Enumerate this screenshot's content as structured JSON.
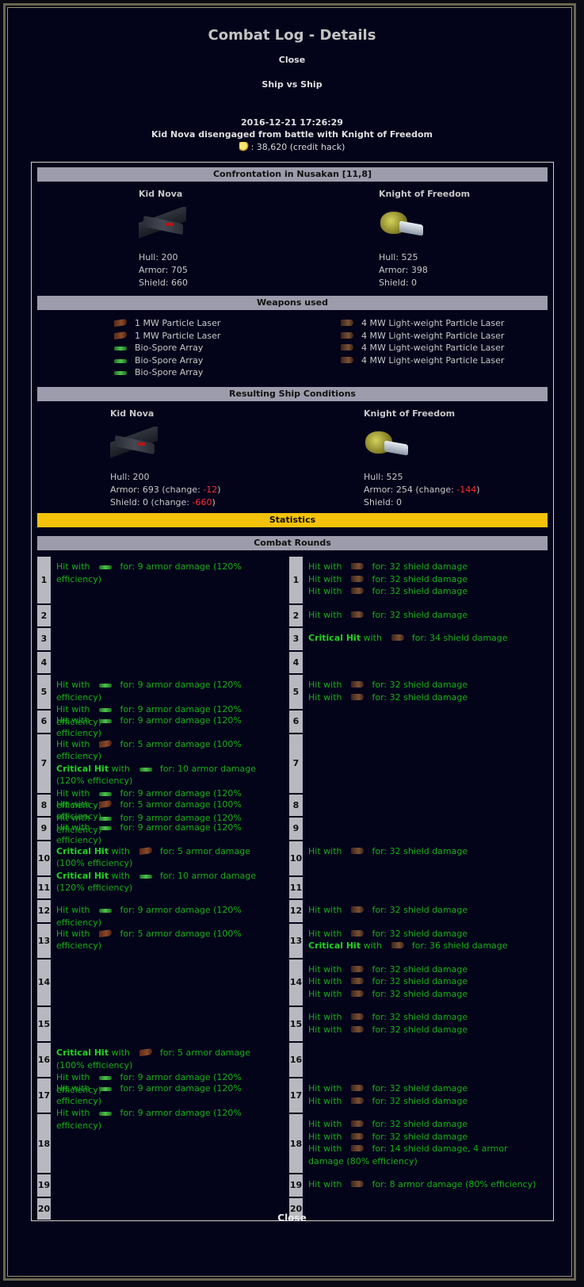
{
  "title": "Combat Log - Details",
  "close_label": "Close",
  "combat_type": "Ship vs Ship",
  "timestamp": "2016-12-21 17:26:29",
  "summary": "Kid Nova disengaged from battle with Knight of Freedom",
  "credits": ": 38,620 (credit hack)",
  "confrontation": "Confrontation in Nusakan [11,8]",
  "attacker": {
    "name": "Kid Nova",
    "hull": "Hull: 200",
    "armor": "Armor: 705",
    "shield": "Shield: 660"
  },
  "defender": {
    "name": "Knight of Freedom",
    "hull": "Hull: 525",
    "armor": "Armor: 398",
    "shield": "Shield: 0"
  },
  "weapons_title": "Weapons used",
  "attacker_weapons": [
    "1 MW Particle Laser",
    "1 MW Particle Laser",
    "Bio-Spore Array",
    "Bio-Spore Array",
    "Bio-Spore Array"
  ],
  "defender_weapons": [
    "4 MW Light-weight Particle Laser",
    "4 MW Light-weight Particle Laser",
    "4 MW Light-weight Particle Laser",
    "4 MW Light-weight Particle Laser"
  ],
  "result_title": "Resulting Ship Conditions",
  "result_attacker": {
    "name": "Kid Nova",
    "hull": "Hull: 200",
    "armor_prefix": "Armor: 693 (change: ",
    "armor_change": "-12",
    "shield_prefix": "Shield: 0 (change: ",
    "shield_change": "-660",
    "suffix": ")"
  },
  "result_defender": {
    "name": "Knight of Freedom",
    "hull": "Hull: 525",
    "armor_prefix": "Armor: 254 (change: ",
    "armor_change": "-144",
    "suffix": ")",
    "shield": "Shield: 0"
  },
  "statistics_label": "Statistics",
  "rounds_title": "Combat Rounds",
  "rounds": [
    {
      "n": "1",
      "left": [
        [
          "Hit with",
          "bio",
          "for: 9 armor damage (120% efficiency)"
        ]
      ],
      "right": [
        [
          "Hit with",
          "laser4",
          "for: 32 shield damage"
        ],
        [
          "Hit with",
          "laser4",
          "for: 32 shield damage"
        ],
        [
          "Hit with",
          "laser4",
          "for: 32 shield damage"
        ]
      ]
    },
    {
      "n": "2",
      "left": [],
      "right": [
        [
          "Hit with",
          "laser4",
          "for: 32 shield damage"
        ]
      ]
    },
    {
      "n": "3",
      "left": [],
      "right": [
        [
          "Critical Hit",
          "laser4",
          "for: 34 shield damage"
        ]
      ]
    },
    {
      "n": "4",
      "left": [],
      "right": []
    },
    {
      "n": "5",
      "left": [
        [
          "Hit with",
          "bio",
          "for: 9 armor damage (120% efficiency)"
        ],
        [
          "Hit with",
          "bio",
          "for: 9 armor damage (120% efficiency)"
        ]
      ],
      "right": [
        [
          "Hit with",
          "laser4",
          "for: 32 shield damage"
        ],
        [
          "Hit with",
          "laser4",
          "for: 32 shield damage"
        ]
      ]
    },
    {
      "n": "6",
      "left": [
        [
          "Hit with",
          "bio",
          "for: 9 armor damage (120% efficiency)"
        ]
      ],
      "right": []
    },
    {
      "n": "7",
      "left": [
        [
          "Hit with",
          "laser",
          "for: 5 armor damage (100% efficiency)"
        ],
        [
          "Critical Hit",
          "bio",
          "for: 10 armor damage (120% efficiency)"
        ],
        [
          "Hit with",
          "bio",
          "for: 9 armor damage (120% efficiency)"
        ],
        [
          "Hit with",
          "bio",
          "for: 9 armor damage (120% efficiency)"
        ]
      ],
      "right": []
    },
    {
      "n": "8",
      "left": [
        [
          "Hit with",
          "laser",
          "for: 5 armor damage (100% efficiency)"
        ]
      ],
      "right": []
    },
    {
      "n": "9",
      "left": [
        [
          "Hit with",
          "bio",
          "for: 9 armor damage (120% efficiency)"
        ]
      ],
      "right": []
    },
    {
      "n": "10",
      "left": [
        [
          "Critical Hit",
          "laser",
          "for: 5 armor damage (100% efficiency)"
        ],
        [
          "Critical Hit",
          "bio",
          "for: 10 armor damage (120% efficiency)"
        ]
      ],
      "right": [
        [
          "Hit with",
          "laser4",
          "for: 32 shield damage"
        ]
      ]
    },
    {
      "n": "11",
      "left": [],
      "right": []
    },
    {
      "n": "12",
      "left": [
        [
          "Hit with",
          "bio",
          "for: 9 armor damage (120% efficiency)"
        ]
      ],
      "right": [
        [
          "Hit with",
          "laser4",
          "for: 32 shield damage"
        ]
      ]
    },
    {
      "n": "13",
      "left": [
        [
          "Hit with",
          "laser",
          "for: 5 armor damage (100% efficiency)"
        ]
      ],
      "right": [
        [
          "Hit with",
          "laser4",
          "for: 32 shield damage"
        ],
        [
          "Critical Hit",
          "laser4",
          "for: 36 shield damage"
        ]
      ]
    },
    {
      "n": "14",
      "left": [],
      "right": [
        [
          "Hit with",
          "laser4",
          "for: 32 shield damage"
        ],
        [
          "Hit with",
          "laser4",
          "for: 32 shield damage"
        ],
        [
          "Hit with",
          "laser4",
          "for: 32 shield damage"
        ]
      ]
    },
    {
      "n": "15",
      "left": [],
      "right": [
        [
          "Hit with",
          "laser4",
          "for: 32 shield damage"
        ],
        [
          "Hit with",
          "laser4",
          "for: 32 shield damage"
        ]
      ]
    },
    {
      "n": "16",
      "left": [
        [
          "Critical Hit",
          "laser",
          "for: 5 armor damage (100% efficiency)"
        ],
        [
          "Hit with",
          "bio",
          "for: 9 armor damage (120% efficiency)"
        ]
      ],
      "right": []
    },
    {
      "n": "17",
      "left": [
        [
          "Hit with",
          "bio",
          "for: 9 armor damage (120% efficiency)"
        ],
        [
          "Hit with",
          "bio",
          "for: 9 armor damage (120% efficiency)"
        ]
      ],
      "right": [
        [
          "Hit with",
          "laser4",
          "for: 32 shield damage"
        ],
        [
          "Hit with",
          "laser4",
          "for: 32 shield damage"
        ]
      ]
    },
    {
      "n": "18",
      "left": [],
      "right": [
        [
          "Hit with",
          "laser4",
          "for: 32 shield damage"
        ],
        [
          "Hit with",
          "laser4",
          "for: 32 shield damage"
        ],
        [
          "Hit with",
          "laser4",
          "for: 14 shield damage, 4 armor damage (80% efficiency)"
        ]
      ]
    },
    {
      "n": "19",
      "left": [],
      "right": [
        [
          "Hit with",
          "laser4",
          "for: 8 armor damage (80% efficiency)"
        ]
      ]
    },
    {
      "n": "20",
      "left": [],
      "right": []
    }
  ],
  "colors": {
    "accent_bar": "#9c9cac",
    "statistics_bar": "#f5c20a",
    "hit_text": "#16b016",
    "change_negative": "#ff3030"
  }
}
